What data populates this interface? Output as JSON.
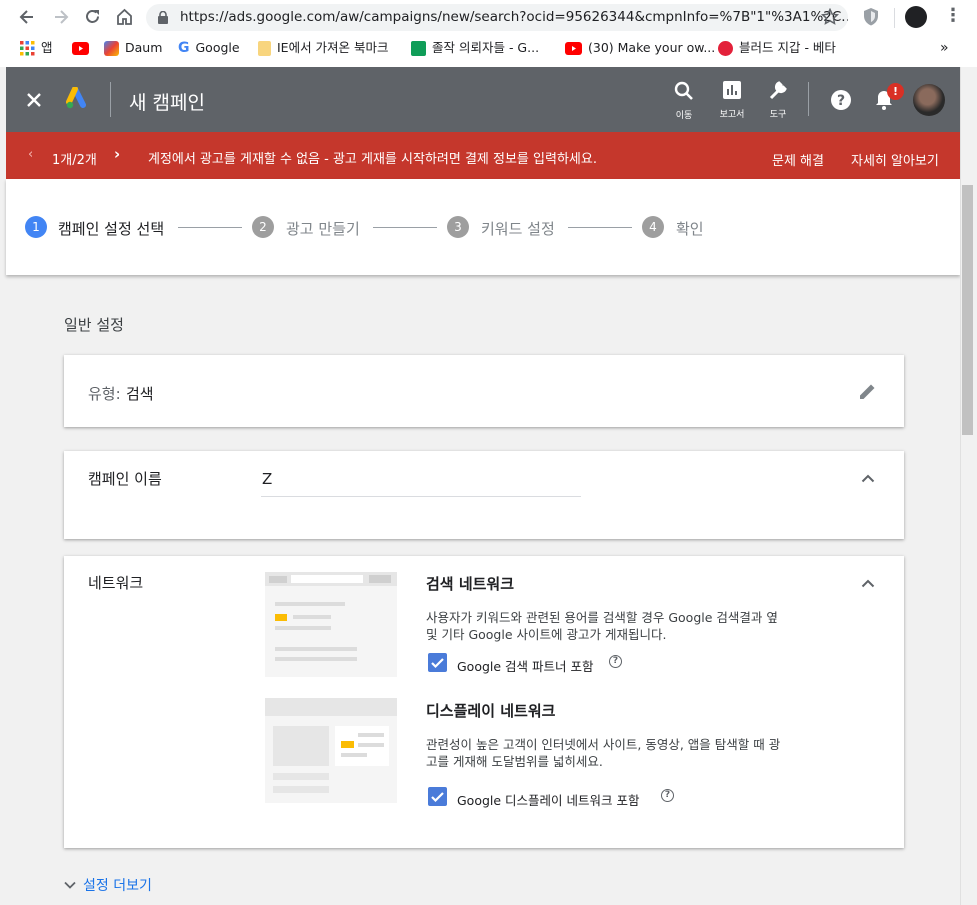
{
  "browser": {
    "url": "https://ads.google.com/aw/campaigns/new/search?ocid=95626344&cmpnInfo=%7B\"1\"%3A1%2C...",
    "bookmarks": [
      {
        "label": "앱",
        "icon": "apps-grid-icon"
      },
      {
        "label": "",
        "icon": "youtube-icon"
      },
      {
        "label": "Daum",
        "icon": "daum-icon"
      },
      {
        "label": "Google",
        "icon": "google-icon"
      },
      {
        "label": "IE에서 가져온 북마크",
        "icon": "folder-icon"
      },
      {
        "label": "졸작 의뢰자들 - G...",
        "icon": "sheets-icon"
      },
      {
        "label": "(30) Make your ow...",
        "icon": "youtube-icon"
      },
      {
        "label": "블러드 지갑 - 베타",
        "icon": "blood-wallet-icon"
      }
    ],
    "overflow": "»"
  },
  "appbar": {
    "title": "새 캠페인",
    "actions": [
      {
        "label": "이동",
        "icon": "search-icon"
      },
      {
        "label": "보고서",
        "icon": "reports-icon"
      },
      {
        "label": "도구",
        "icon": "wrench-icon"
      }
    ],
    "notification_badge": "!"
  },
  "alert": {
    "pager": "1개/2개",
    "message": "계정에서 광고를 게재할 수 없음 - 광고 게재를 시작하려면 결제 정보를 입력하세요.",
    "fix_label": "문제 해결",
    "learn_more_label": "자세히 알아보기",
    "color": "#c5372c"
  },
  "steps": [
    {
      "num": "1",
      "label": "캠페인 설정 선택",
      "active": true
    },
    {
      "num": "2",
      "label": "광고 만들기",
      "active": false
    },
    {
      "num": "3",
      "label": "키워드 설정",
      "active": false
    },
    {
      "num": "4",
      "label": "확인",
      "active": false
    }
  ],
  "main": {
    "section_title": "일반 설정",
    "type_card": {
      "label": "유형:",
      "value": "검색"
    },
    "name_card": {
      "label": "캠페인 이름",
      "value": "Z"
    },
    "network_card": {
      "label": "네트워크",
      "search": {
        "title": "검색 네트워크",
        "description": "사용자가 키워드와 관련된 용어를 검색할 경우 Google 검색결과 옆 및 기타 Google 사이트에 광고가 게재됩니다.",
        "desc_line1": "사용자가 키워드와 관련된 용어를 검색할 경우 Google 검색결과 옆",
        "desc_line2": "및 기타 Google 사이트에 광고가 게재됩니다.",
        "checkbox_label": "Google 검색 파트너 포함",
        "checked": true
      },
      "display": {
        "title": "디스플레이 네트워크",
        "desc_line1": "관련성이 높은 고객이 인터넷에서 사이트, 동영상, 앱을 탐색할 때 광",
        "desc_line2": "고를 게재해 도달범위를 넓히세요.",
        "checkbox_label": "Google 디스플레이 네트워크 포함",
        "checked": true
      }
    },
    "more_settings": "설정 더보기"
  },
  "colors": {
    "accent": "#4285f4",
    "appbar": "#5f6368",
    "link": "#1a73e8"
  }
}
